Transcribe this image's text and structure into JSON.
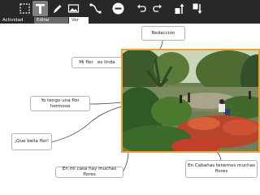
{
  "toolbar": {
    "tools": [
      {
        "name": "select-tool",
        "icon": "dashed-rect-icon"
      },
      {
        "name": "text-tool",
        "icon": "text-T-icon",
        "active": true
      },
      {
        "name": "pen-tool",
        "icon": "pencil-icon"
      },
      {
        "name": "image-tool",
        "icon": "image-icon"
      },
      {
        "name": "link-tool",
        "icon": "connector-icon"
      },
      {
        "name": "delete-tool",
        "icon": "minus-circle-icon"
      },
      {
        "name": "undo-tool",
        "icon": "undo-icon"
      },
      {
        "name": "redo-tool",
        "icon": "redo-icon"
      },
      {
        "name": "move-up-tool",
        "icon": "move-up-icon"
      },
      {
        "name": "move-down-tool",
        "icon": "move-down-icon"
      }
    ]
  },
  "tabs": {
    "activity": "Actividad",
    "edit": "Editar",
    "view": "Ver"
  },
  "nodes": {
    "redaccion": "Redacción",
    "mi_flor": "Mi flor   es linda",
    "tengo_flor": "Yo tengo una flor hermosa",
    "que_bella": "¡Que bella flor!",
    "mi_casa": "En mi casa hay muchas flores",
    "cabanas": "En Cabañas tenemos muchas flores"
  },
  "colors": {
    "toolbar_bg": "#282828",
    "selection_border": "#f0a033",
    "node_border": "#b5b5b5"
  }
}
